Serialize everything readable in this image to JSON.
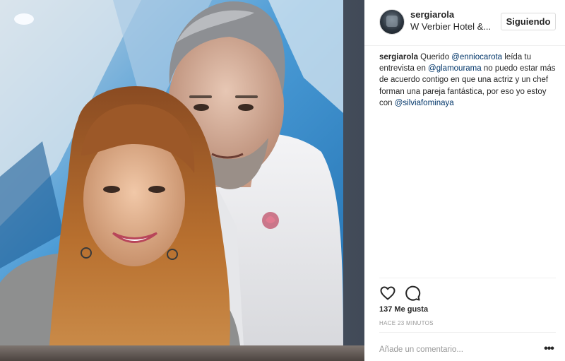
{
  "post": {
    "username": "sergiarola",
    "location": "W Verbier Hotel &...",
    "follow_label": "Siguiendo",
    "caption": {
      "author": "sergiarola",
      "t1": " Querido ",
      "m1": "@enniocarota",
      "t2": " leída tu entrevista en ",
      "m2": "@glamourama",
      "t3": " no puedo estar más de acuerdo contigo en que una actriz y un chef forman una pareja fantástica, por eso yo estoy con ",
      "m3": "@silviafominaya"
    },
    "likes": "137 Me gusta",
    "time": "HACE 23 MINUTOS",
    "comment_placeholder": "Añade un comentario...",
    "more_label": "•••"
  },
  "icons": {
    "like": "heart-icon",
    "comment": "comment-bubble-icon",
    "more": "ellipsis-icon"
  },
  "colors": {
    "mention": "#003569",
    "border": "#efefef",
    "muted": "#999999"
  }
}
